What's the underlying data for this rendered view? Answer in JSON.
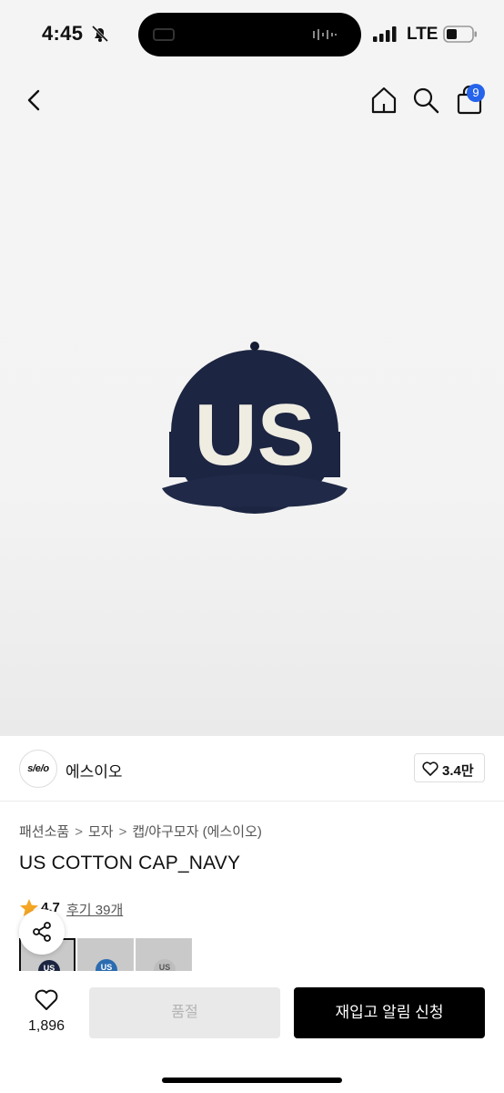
{
  "status_bar": {
    "time": "4:45",
    "network": "LTE"
  },
  "nav": {
    "bag_count": "9"
  },
  "product_image": {
    "cap_text": "US",
    "cap_color": "#1c2541",
    "letter_color": "#efece2"
  },
  "brand": {
    "logo_text": "s/e/o",
    "name": "에스이오",
    "likes": "3.4만"
  },
  "breadcrumb": [
    "패션소품",
    "모자",
    "캡/야구모자 (에스이오)"
  ],
  "product": {
    "title": "US COTTON CAP_NAVY",
    "rating": "4.7",
    "reviews_label": "후기 39개"
  },
  "thumbnails": [
    {
      "label": "US",
      "color": "#1c2541"
    },
    {
      "label": "US",
      "color": "#2b6cb0"
    },
    {
      "label": "US",
      "color": "#bdbdbd"
    }
  ],
  "bottom": {
    "wish_count": "1,896",
    "soldout_label": "품절",
    "restock_label": "재입고 알림 신청"
  },
  "colors": {
    "accent_badge": "#2563eb",
    "star": "#f5a623"
  }
}
